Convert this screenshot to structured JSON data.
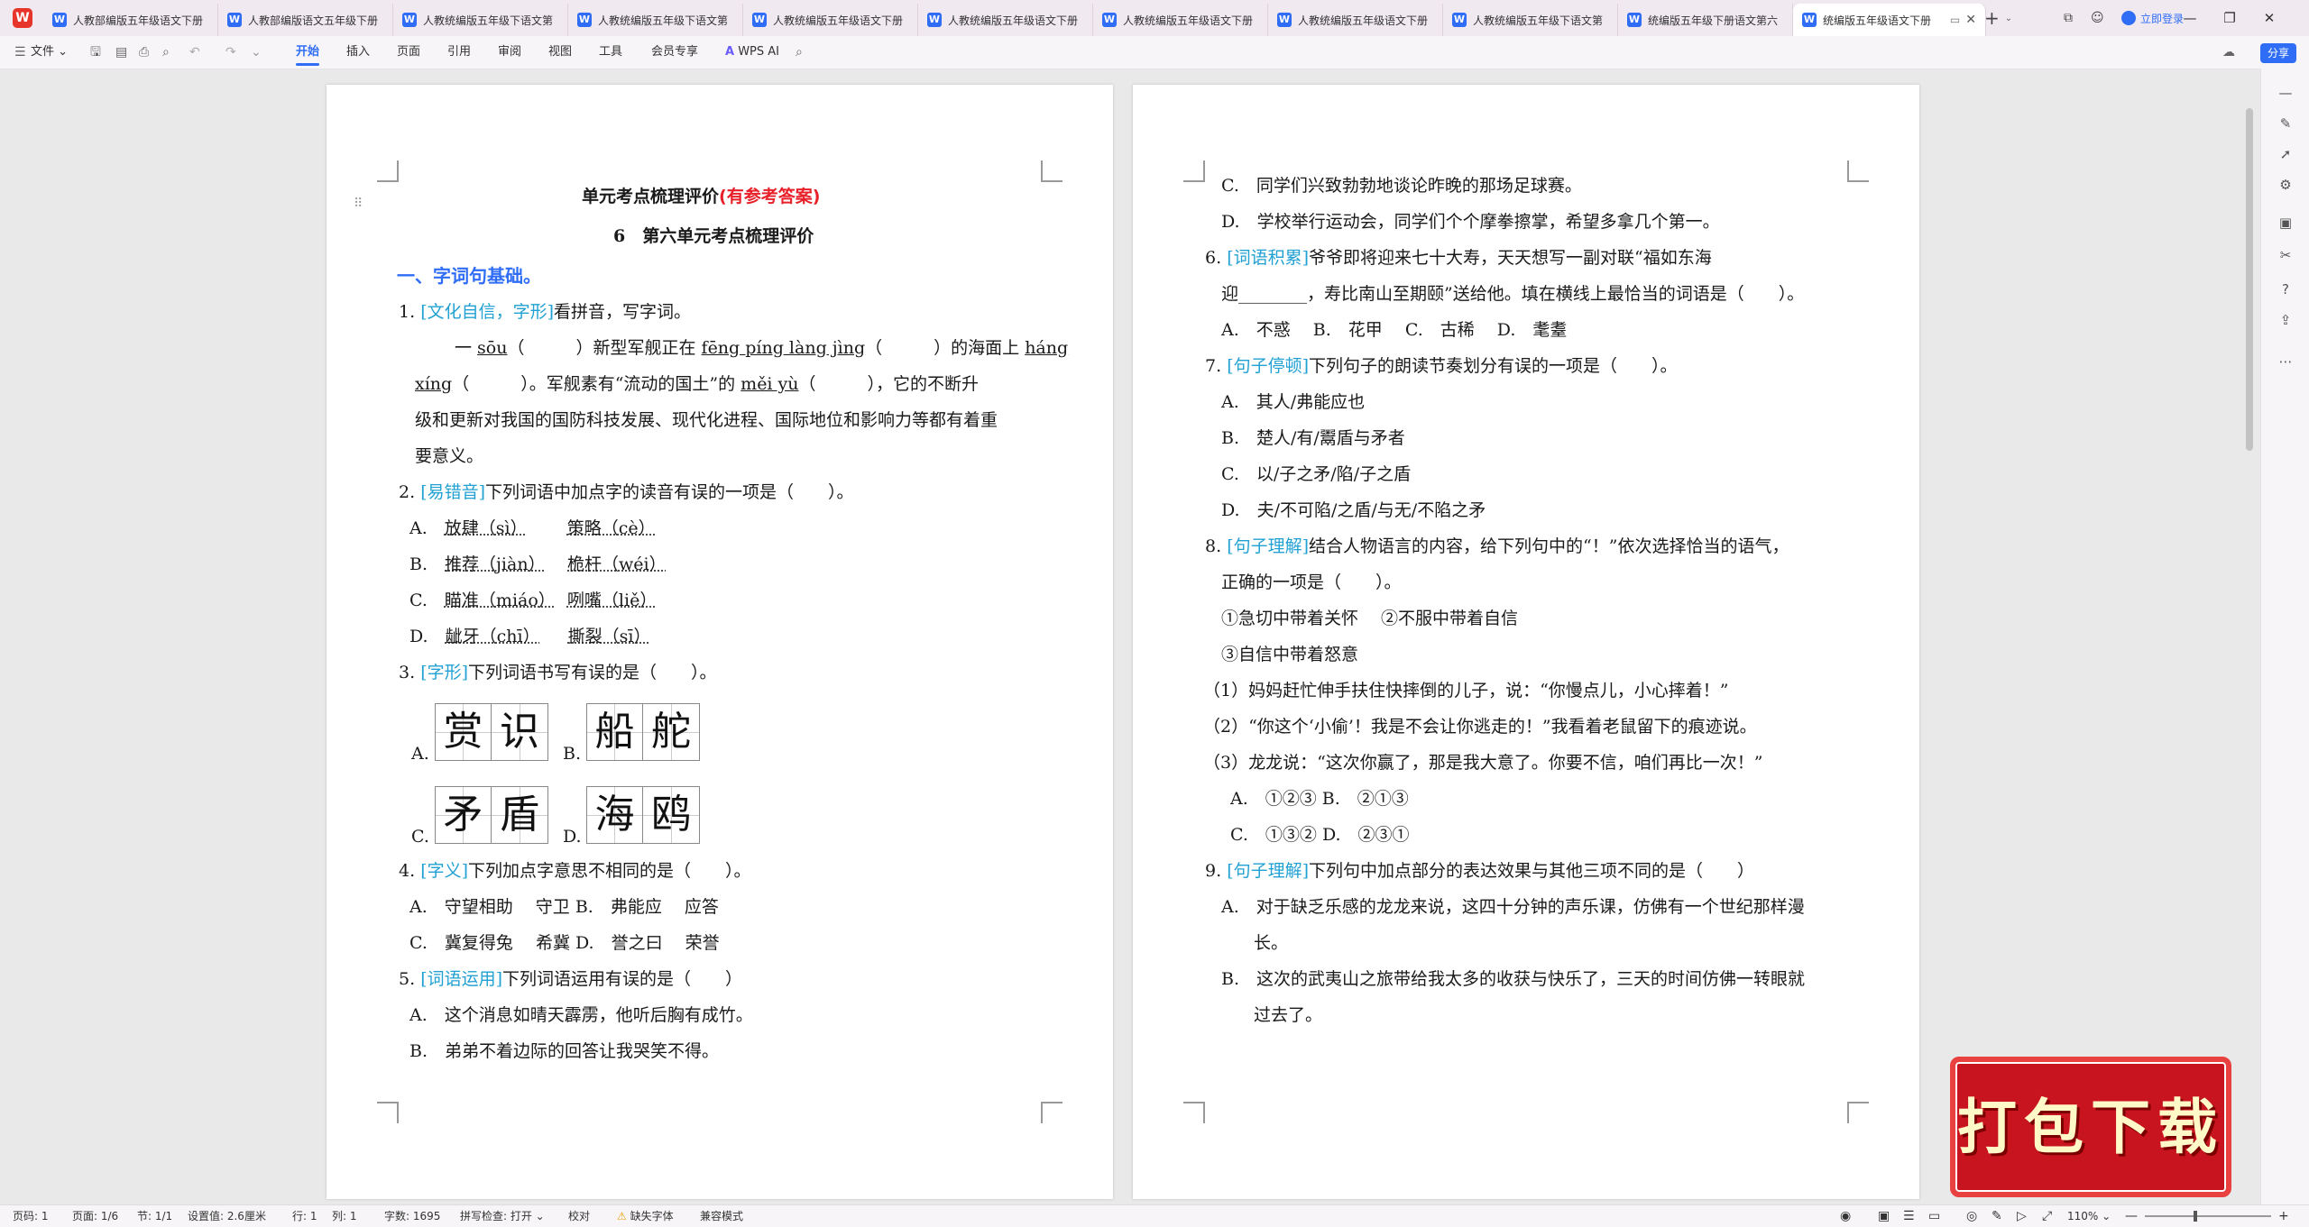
{
  "app": {
    "logo": "W"
  },
  "tabs": [
    {
      "label": "人教部编版五年级语文下册"
    },
    {
      "label": "人教部编版语文五年级下册"
    },
    {
      "label": "人教统编版五年级下语文第"
    },
    {
      "label": "人教统编版五年级下语文第"
    },
    {
      "label": "人教统编版五年级语文下册"
    },
    {
      "label": "人教统编版五年级语文下册"
    },
    {
      "label": "人教统编版五年级语文下册"
    },
    {
      "label": "人教统编版五年级语文下册"
    },
    {
      "label": "人教统编版五年级下语文第"
    },
    {
      "label": "统编版五年级下册语文第六"
    },
    {
      "label": "统编版五年级语文下册"
    }
  ],
  "titlebar": {
    "new_tab": "+",
    "login": "立即登录"
  },
  "ribbon": {
    "file": "文件",
    "tabs": [
      "开始",
      "插入",
      "页面",
      "引用",
      "审阅",
      "视图",
      "工具",
      "会员专享"
    ],
    "active_tab": "开始",
    "wps_ai": "WPS AI",
    "share": "分享"
  },
  "page1": {
    "title": "单元考点梳理评价",
    "title_red": "(有参考答案)",
    "subtitle": "6　第六单元考点梳理评价",
    "section1": "一、字词句基础。",
    "q1": {
      "num": "1.",
      "tag": "[文化自信，字形]",
      "text": "看拼音，写字词。"
    },
    "q1_l1": [
      "一 ",
      "sōu",
      "（　　　）新型军舰正在 ",
      "fēng píng làng jìng",
      "（　　　）的海面上 ",
      "háng"
    ],
    "q1_l2": [
      "xíng",
      "（　　　）。军舰素有“流动的国土”的 ",
      "měi yù",
      "（　　　），它的不断升"
    ],
    "q1_l3": "级和更新对我国的国防科技发展、现代化进程、国际地位和影响力等都有着重",
    "q1_l4": "要意义。",
    "q2": {
      "num": "2.",
      "tag": "[易错音]",
      "text": "下列词语中加点字的读音有误的一项是（　　）。"
    },
    "q2_opts": [
      {
        "l": "A.",
        "a": "放肆（sì）",
        "b": "策略（cè）"
      },
      {
        "l": "B.",
        "a": "推荐（jiàn）",
        "b": "桅杆（wéi）"
      },
      {
        "l": "C.",
        "a": "瞄准（miáo）",
        "b": "咧嘴（liě）"
      },
      {
        "l": "D.",
        "a": "龇牙（chī）",
        "b": "撕裂（sī）"
      }
    ],
    "q3": {
      "num": "3.",
      "tag": "[字形]",
      "text": "下列词语书写有误的是（　　）。"
    },
    "q3_opts": [
      {
        "l": "A.",
        "w": [
          "赏",
          "识"
        ]
      },
      {
        "l": "B.",
        "w": [
          "船",
          "舵"
        ]
      },
      {
        "l": "C.",
        "w": [
          "矛",
          "盾"
        ]
      },
      {
        "l": "D.",
        "w": [
          "海",
          "鸥"
        ]
      }
    ],
    "q4": {
      "num": "4.",
      "tag": "[字义]",
      "text": "下列加点字意思不相同的是（　　）。"
    },
    "q4_l1": "A.　守望相助　 守卫 B.　弗能应　 应答",
    "q4_l2": "C.　冀复得兔　 希冀 D.　誉之曰　 荣誉",
    "q5": {
      "num": "5.",
      "tag": "[词语运用]",
      "text": "下列词语运用有误的是（　　）"
    },
    "q5_a": "A.　这个消息如晴天霹雳，他听后胸有成竹。",
    "q5_b": "B.　弟弟不着边际的回答让我哭笑不得。"
  },
  "page2": {
    "q5_c": "C.　同学们兴致勃勃地谈论昨晚的那场足球赛。",
    "q5_d": "D.　学校举行运动会，同学们个个摩拳擦掌，希望多拿几个第一。",
    "q6": {
      "num": "6.",
      "tag": "[词语积累]",
      "text": "爷爷即将迎来七十大寿，天天想写一副对联“福如东海"
    },
    "q6_l2": "迎________，寿比南山至期颐”送给他。填在横线上最恰当的词语是（　　）。",
    "q6_opts": "A.　不惑　 B.　花甲　 C.　古稀　 D.　耄耋",
    "q7": {
      "num": "7.",
      "tag": "[句子停顿]",
      "text": "下列句子的朗读节奏划分有误的一项是（　　）。"
    },
    "q7_opts": [
      "A.　其人/弗能应也",
      "B.　楚人/有/鬻盾与矛者",
      "C.　以/子之矛/陷/子之盾",
      "D.　夫/不可陷/之盾/与无/不陷之矛"
    ],
    "q8": {
      "num": "8.",
      "tag": "[句子理解]",
      "text": "结合人物语言的内容，给下列句中的“！”依次选择恰当的语气，"
    },
    "q8_l2": "正确的一项是（　　）。",
    "q8_l3": "①急切中带着关怀　 ②不服中带着自信",
    "q8_l4": "③自信中带着怒意",
    "q8_s1": "（1）妈妈赶忙伸手扶住快摔倒的儿子，说：“你慢点儿，小心摔着！”",
    "q8_s2": "（2）“你这个‘小偷’！我是不会让你逃走的！”我看着老鼠留下的痕迹说。",
    "q8_s3": "（3）龙龙说：“这次你赢了，那是我大意了。你要不信，咱们再比一次！”",
    "q8_o1": "A.　①②③ B.　②①③",
    "q8_o2": "C.　①③② D.　②③①",
    "q9": {
      "num": "9.",
      "tag": "[句子理解]",
      "text": "下列句中加点部分的表达效果与其他三项不同的是（　　）"
    },
    "q9_a1": "A.　对于缺乏乐感的龙龙来说，这四十分钟的声乐课，仿佛有一个世纪那样漫",
    "q9_a2": "长。",
    "q9_b1": "B.　这次的武夷山之旅带给我太多的收获与快乐了，三天的时间仿佛一转眼就",
    "q9_b2": "过去了。"
  },
  "promo": {
    "label": "打包下载"
  },
  "status": {
    "page_code": "页码: 1",
    "page": "页面: 1/6",
    "section": "节: 1/1",
    "setting": "设置值: 2.6厘米",
    "row": "行: 1",
    "col": "列: 1",
    "words": "字数: 1695",
    "spell": "拼写检查: 打开",
    "proof": "校对",
    "missing_font": "缺失字体",
    "compat": "兼容模式",
    "zoom": "110%"
  }
}
